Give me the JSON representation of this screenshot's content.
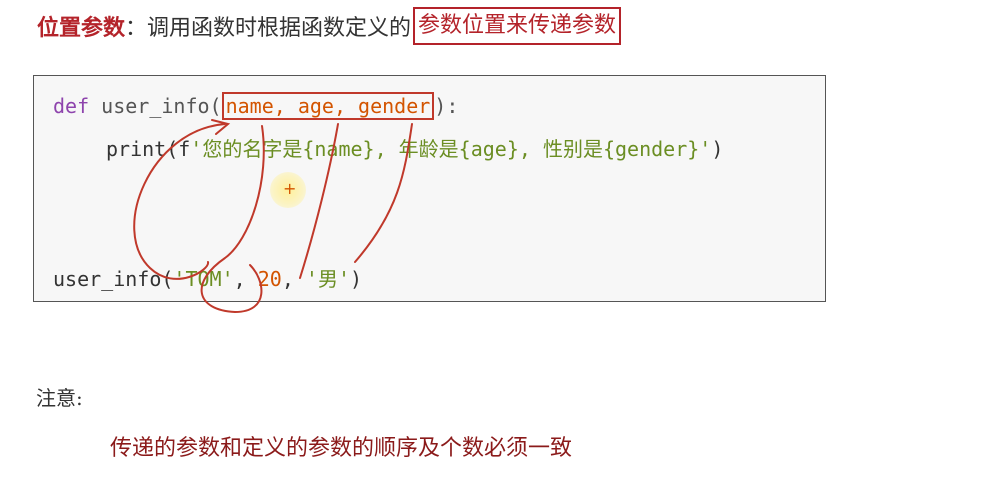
{
  "heading": {
    "term": "位置参数",
    "colon": "：",
    "body": "调用函数时根据函数定义的",
    "boxed": "参数位置来传递参数"
  },
  "code": {
    "line1": {
      "keyword": "def",
      "name": "user_info",
      "open": "(",
      "params": "name, age, gender",
      "close": "):"
    },
    "line2": {
      "prefix": "print(f",
      "string": "'您的名字是{name}, 年龄是{age}, 性别是{gender}'",
      "suffix": ")"
    },
    "line3": {
      "name": "user_info",
      "open": "(",
      "arg1": "'TOM'",
      "sep1": ", ",
      "arg2": "20",
      "sep2": ", ",
      "arg3": "'男'",
      "close": ")"
    }
  },
  "note": {
    "label": "注意:",
    "text": "传递的参数和定义的参数的顺序及个数必须一致"
  },
  "colors": {
    "accent": "#b4232a",
    "annotation_ink": "#c0392b",
    "code_background": "#f7f7f7"
  }
}
